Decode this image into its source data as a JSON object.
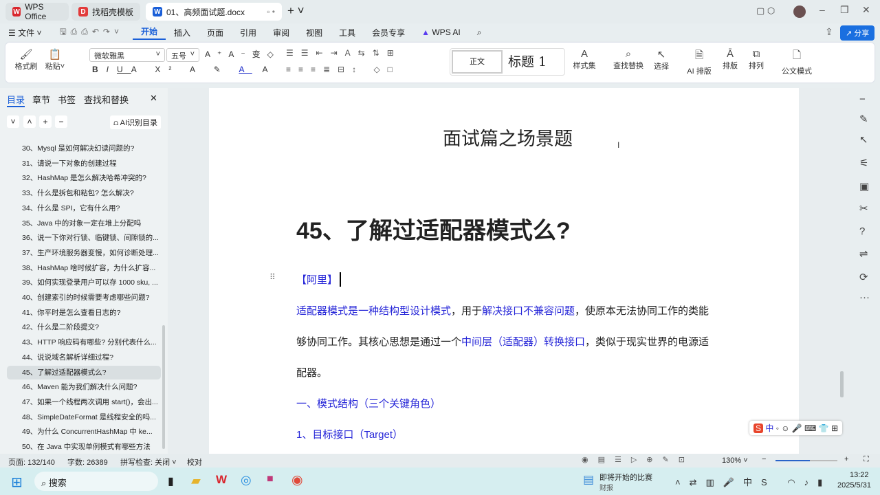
{
  "tabs": [
    {
      "label": "WPS Office",
      "color": "#d9272e"
    },
    {
      "label": "找稻壳模板",
      "color": "#e23b3b"
    },
    {
      "label": "01、高频面试题.docx",
      "color": "#1a5fd8"
    }
  ],
  "menubar": {
    "file": "文件",
    "items": [
      "开始",
      "插入",
      "页面",
      "引用",
      "审阅",
      "视图",
      "工具",
      "会员专享"
    ],
    "ai": "WPS AI",
    "share": "分享"
  },
  "ribbon": {
    "format_painter": "格式刷",
    "paste": "粘贴",
    "font": "微软雅黑",
    "size": "五号",
    "style_normal": "正文",
    "style_h1": "标题 1",
    "style_set": "样式集",
    "find_replace": "查找替换",
    "select": "选择",
    "ai_layout": "AI 排版",
    "layout": "排版",
    "arrange": "排列",
    "official": "公文模式"
  },
  "sidebar": {
    "tabs": [
      "目录",
      "章节",
      "书签",
      "查找和替换"
    ],
    "ai_toc": "AI识别目录",
    "items": [
      "30、Mysql 是如何解决幻读问题的?",
      "31、请说一下对象的创建过程",
      "32、HashMap 是怎么解决哈希冲突的?",
      "33、什么是拆包和粘包? 怎么解决?",
      "34、什么是 SPI，它有什么用?",
      "35、Java 中的对象一定在堆上分配吗",
      "36、说一下你对行锁、临键锁、间隙锁的...",
      "37、生产环境服务器变慢，如何诊断处理...",
      "38、HashMap 啥时候扩容，为什么扩容...",
      "39、如何实现登录用户可以存 1000 sku, ...",
      "40、创建索引的时候需要考虑哪些问题?",
      "41、你平时是怎么查看日志的?",
      "42、什么是二阶段提交?",
      "43、HTTP 响应码有哪些? 分别代表什么...",
      "44、说说域名解析详细过程?",
      "45、了解过适配器模式么?",
      "46、Maven 能为我们解决什么问题?",
      "47、如果一个线程两次调用 start()，会出...",
      "48、SimpleDateFormat 是线程安全的吗...",
      "49、为什么 ConcurrentHashMap 中 ke...",
      "50、在 Java 中实现单例模式有哪些方法"
    ],
    "selected_index": 15
  },
  "doc": {
    "section_title": "面试篇之场景题",
    "heading": "45、了解过适配器模式么?",
    "tag": "【阿里】",
    "p1": [
      {
        "t": "适配器模式是一种结构型设计模式",
        "b": true
      },
      {
        "t": "，用于",
        "b": false
      },
      {
        "t": "解决接口不兼容问题",
        "b": true
      },
      {
        "t": "，使原本无法协同工作的类能",
        "b": false
      }
    ],
    "p2": [
      {
        "t": "够协同工作。其核心思想是通过一个",
        "b": false
      },
      {
        "t": "中间层（适配器）转换接口",
        "b": true
      },
      {
        "t": "，类似于现实世界的电源适",
        "b": false
      }
    ],
    "p3": "配器。",
    "h2": "一、模式结构（三个关键角色）",
    "h3": "1、目标接口（Target）"
  },
  "status": {
    "page": "页面: 132/140",
    "words": "字数: 26389",
    "spell": "拼写检查: 关闭",
    "proof": "校对",
    "zoom": "130%",
    "zoom_fraction": 0.55
  },
  "taskbar": {
    "search": "搜索",
    "news_title": "即将开始的比赛",
    "news_sub": "财报",
    "time": "13:22",
    "date": "2025/5/31"
  },
  "ime": {
    "lang": "中"
  }
}
